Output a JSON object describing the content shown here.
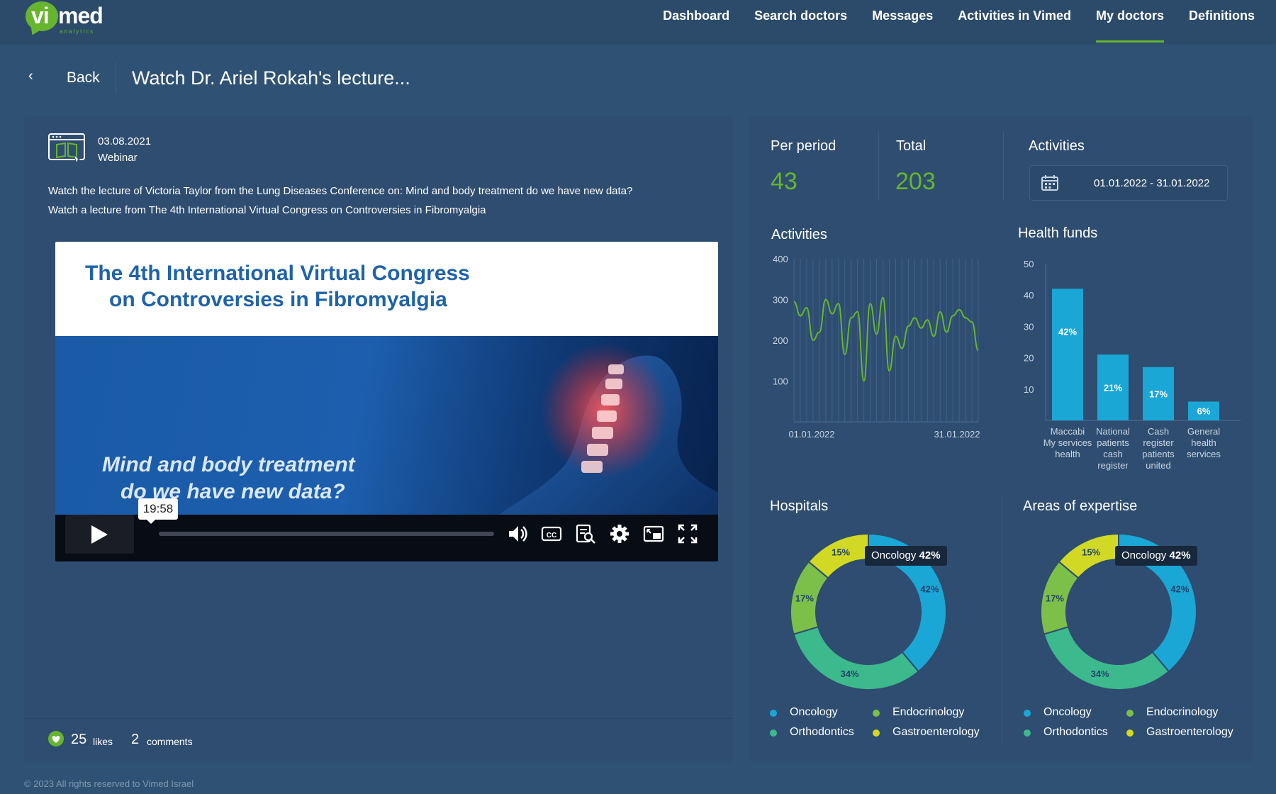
{
  "brand": {
    "name_part1": "vi",
    "name_part2": "med",
    "tagline": "analytics",
    "color": "#67b52f"
  },
  "nav": {
    "items": [
      {
        "label": "Dashboard",
        "active": false
      },
      {
        "label": "Search doctors",
        "active": false
      },
      {
        "label": "Messages",
        "active": false
      },
      {
        "label": "Activities in Vimed",
        "active": false
      },
      {
        "label": "My doctors",
        "active": true
      },
      {
        "label": "Definitions",
        "active": false
      }
    ]
  },
  "header": {
    "back_label": "Back",
    "title": "Watch Dr. Ariel Rokah's lecture..."
  },
  "event": {
    "date": "03.08.2021",
    "type": "Webinar",
    "description": [
      "Watch the lecture of Victoria Taylor from the Lung Diseases Conference on: Mind and body treatment do we have new data?",
      "Watch a  lecture from The 4th International Virtual Congress on Controversies in Fibromyalgia"
    ]
  },
  "video": {
    "banner_line1": "The 4th International Virtual Congress",
    "banner_line2": "on Controversies in Fibromyalgia",
    "subtitle_line1": "Mind and body treatment",
    "subtitle_line2": "do we have new data?",
    "hover_time": "19:58",
    "progress": 0.0
  },
  "footer": {
    "likes_count": "25",
    "likes_label": "likes",
    "comments_count": "2",
    "comments_label": "comments"
  },
  "copyright": "© 2023 All rights reserved to Vimed Israel",
  "stats": {
    "per_period_label": "Per period",
    "per_period_value": "43",
    "total_label": "Total",
    "total_value": "203",
    "activities_label": "Activities",
    "date_range": "01.01.2022 - 31.01.2022"
  },
  "sections": {
    "activities": "Activities",
    "health_funds": "Health funds",
    "hospitals": "Hospitals",
    "expertise": "Areas of expertise"
  },
  "chart_data": [
    {
      "type": "line",
      "title": "Activities",
      "x_start": "01.01.2022",
      "x_end": "31.01.2022",
      "x_ticks": [
        "01.01.2022",
        "31.01.2022"
      ],
      "y_ticks": [
        "100",
        "200",
        "300",
        "400"
      ],
      "ylim": [
        0,
        400
      ],
      "grid": true,
      "color": "#67b52f",
      "values": [
        295,
        260,
        280,
        200,
        220,
        300,
        265,
        290,
        165,
        255,
        270,
        100,
        290,
        215,
        305,
        125,
        210,
        180,
        235,
        255,
        230,
        250,
        210,
        270,
        220,
        260,
        275,
        255,
        245,
        175
      ]
    },
    {
      "type": "bar",
      "title": "Health funds",
      "categories": [
        [
          "Maccabi",
          "health"
        ],
        [
          "My services",
          "health"
        ],
        [
          "National",
          "patients",
          "cash",
          "register"
        ],
        [
          "Cash",
          "register",
          "patients",
          "united"
        ],
        [
          "General",
          "health",
          "services"
        ]
      ],
      "category_labels_printed": [
        {
          "lines": [
            "Maccabi",
            "My services",
            "health"
          ]
        },
        {
          "lines": [
            "National",
            "patients",
            "cash",
            "register"
          ]
        },
        {
          "lines": [
            "Cash",
            "register",
            "patients",
            "united"
          ]
        },
        {
          "lines": [
            "General",
            "health",
            "services"
          ]
        }
      ],
      "values": [
        42,
        21,
        17,
        6
      ],
      "data_labels": [
        "42%",
        "21%",
        "17%",
        "6%"
      ],
      "y_ticks": [
        "10",
        "20",
        "30",
        "40",
        "50"
      ],
      "ylim": [
        0,
        50
      ],
      "color": "#1ba7d6",
      "grid": false
    },
    {
      "type": "pie",
      "title": "Hospitals",
      "donut": true,
      "slices": [
        {
          "name": "Oncology",
          "value": 42,
          "label": "42%",
          "color": "#1ba7d6"
        },
        {
          "name": "Orthodontics",
          "value": 34,
          "label": "34%",
          "color": "#3cb98d"
        },
        {
          "name": "Endocrinology",
          "value": 17,
          "label": "17%",
          "color": "#7cc04a"
        },
        {
          "name": "Gastroenterology",
          "value": 15,
          "label": "15%",
          "color": "#d2d924"
        }
      ],
      "tooltip": {
        "name": "Oncology",
        "value": "42%"
      },
      "legend": "bottom"
    },
    {
      "type": "pie",
      "title": "Areas of expertise",
      "donut": true,
      "slices": [
        {
          "name": "Oncology",
          "value": 42,
          "label": "42%",
          "color": "#1ba7d6"
        },
        {
          "name": "Orthodontics",
          "value": 34,
          "label": "34%",
          "color": "#3cb98d"
        },
        {
          "name": "Endocrinology",
          "value": 17,
          "label": "17%",
          "color": "#7cc04a"
        },
        {
          "name": "Gastroenterology",
          "value": 15,
          "label": "15%",
          "color": "#d2d924"
        }
      ],
      "tooltip": {
        "name": "Oncology",
        "value": "42%"
      },
      "legend": "bottom"
    }
  ],
  "icons": {
    "back": "chevron-left-icon",
    "event": "webinar-icon",
    "calendar": "calendar-icon",
    "like": "heart-icon",
    "play": "play-icon",
    "volume": "volume-icon",
    "cc": "captions-icon",
    "transcript": "transcript-icon",
    "settings": "gear-icon",
    "pip": "picture-in-picture-icon",
    "fullscreen": "fullscreen-icon"
  }
}
